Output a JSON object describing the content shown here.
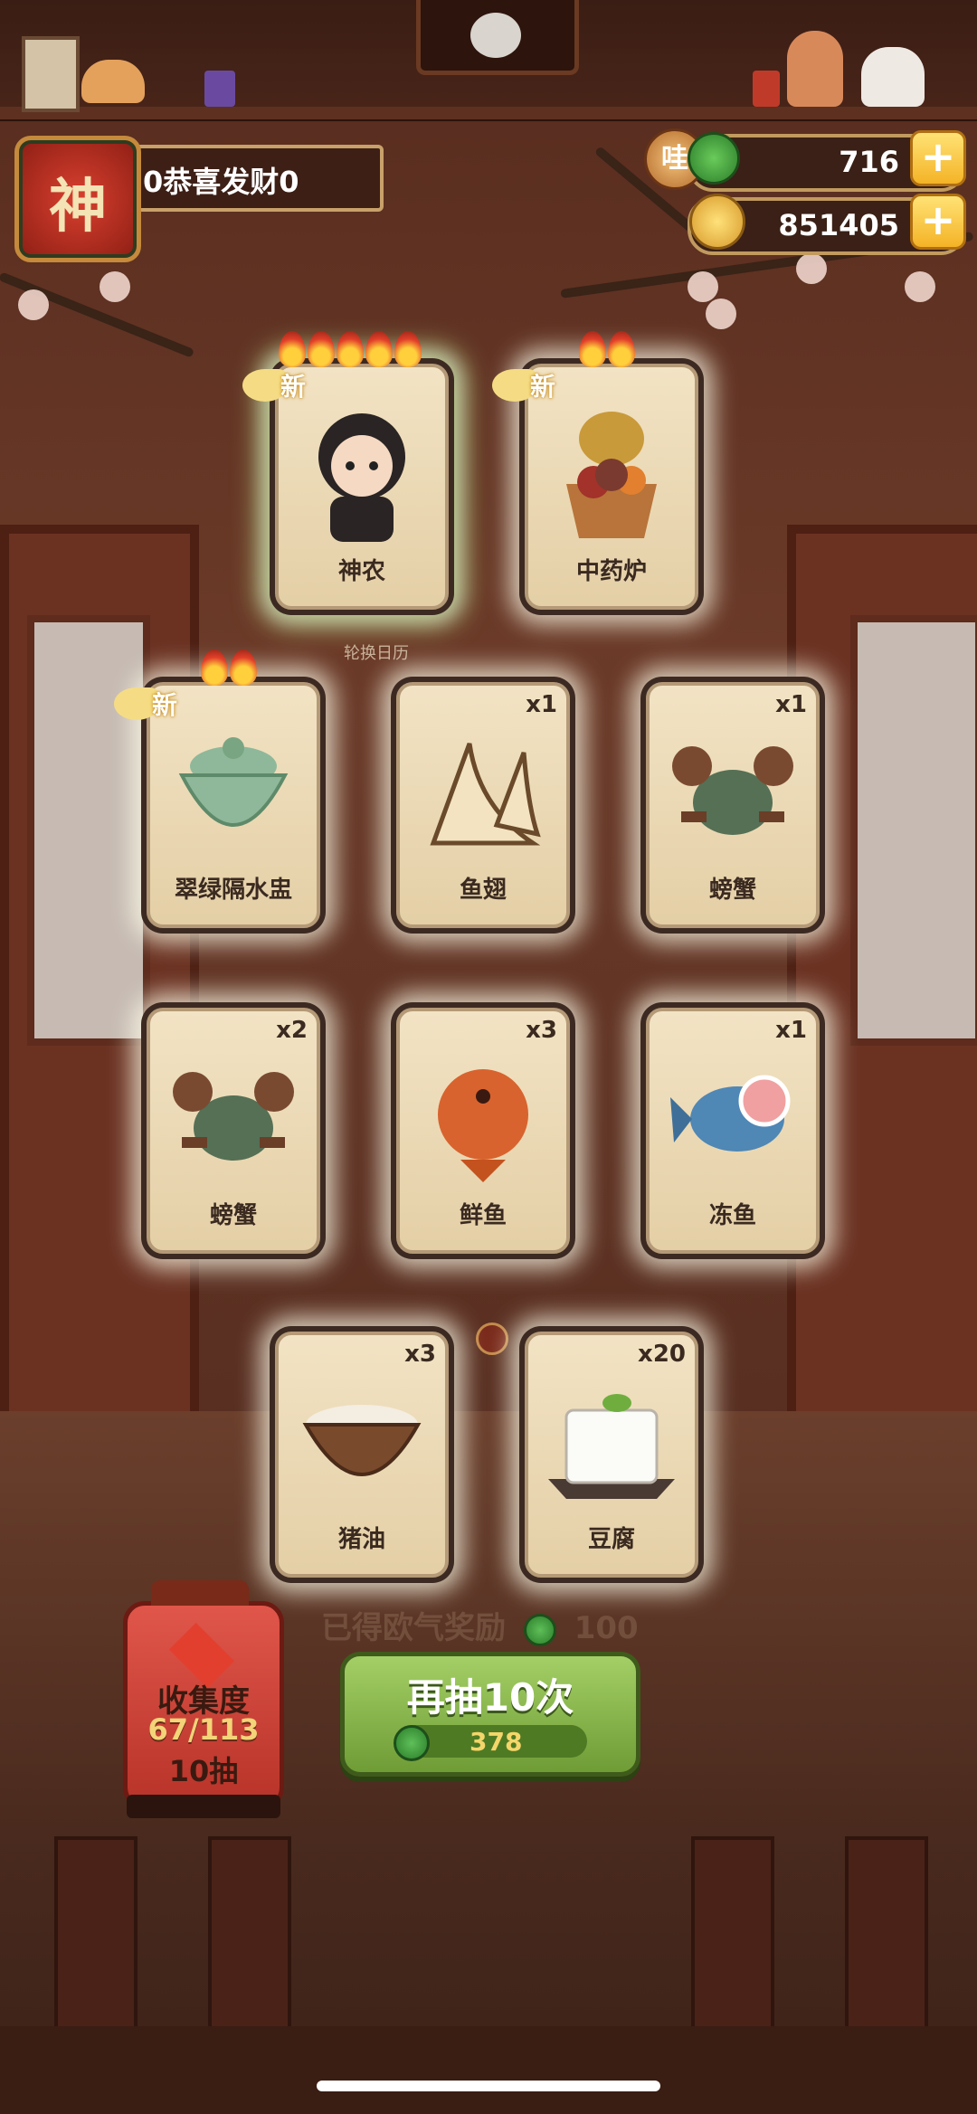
{
  "player": {
    "name": "0恭喜发财0",
    "avatar_glyph": "神"
  },
  "currency": {
    "jade": {
      "value": "716",
      "badge": "哇"
    },
    "coins": {
      "value": "851405"
    }
  },
  "row_label": "轮换日历",
  "cards": [
    {
      "label": "神农",
      "qty": "",
      "new_tag": "新",
      "flames": 5
    },
    {
      "label": "中药炉",
      "qty": "",
      "new_tag": "新",
      "flames": 2
    },
    {
      "label": "翠绿隔水盅",
      "qty": "",
      "new_tag": "新",
      "flames": 2
    },
    {
      "label": "鱼翅",
      "qty": "x1"
    },
    {
      "label": "螃蟹",
      "qty": "x1"
    },
    {
      "label": "螃蟹",
      "qty": "x2"
    },
    {
      "label": "鲜鱼",
      "qty": "x3"
    },
    {
      "label": "冻鱼",
      "qty": "x1"
    },
    {
      "label": "猪油",
      "qty": "x3"
    },
    {
      "label": "豆腐",
      "qty": "x20"
    }
  ],
  "collection": {
    "title": "收集度",
    "progress": "67/113",
    "draws": "10抽"
  },
  "draw_button": {
    "label": "再抽10次",
    "cost": "378"
  },
  "ghost_text": "已得欧气奖励",
  "ghost_value": "100",
  "colors": {
    "accent_green": "#7fae45",
    "lantern_red": "#c93a2e",
    "gold": "#f4b326"
  }
}
